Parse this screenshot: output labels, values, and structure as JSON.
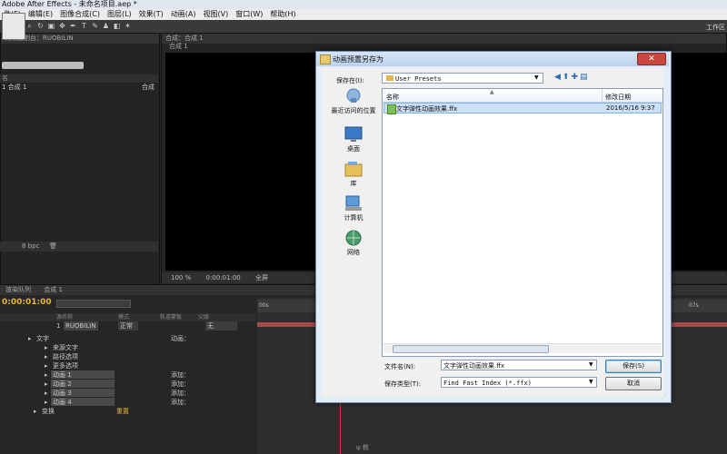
{
  "app": {
    "window_title": "Adobe After Effects - 未命名项目.aep *",
    "menu": [
      "件(F)",
      "编辑(E)",
      "图像合成(C)",
      "图层(L)",
      "效果(T)",
      "动画(A)",
      "视图(V)",
      "窗口(W)",
      "帮助(H)"
    ],
    "workspace_label": "工作区"
  },
  "project": {
    "tab_label": "特效控制台：RUOBILIN",
    "header_label": "名",
    "comp_item": "1 合成 1",
    "side_label": "合成",
    "bpc": "8 bpc"
  },
  "viewer": {
    "tab_label": "合成：合成 1",
    "sub_tab": "合成 1",
    "zoom": "100 %",
    "time": "0:00:01:00",
    "view": "全屏"
  },
  "timeline": {
    "tabs": [
      "渲染队列",
      "合成 1"
    ],
    "timecode": "0:00:01:00",
    "col_head": "源名称",
    "col_mode": "模式",
    "col_track": "轨道蒙板",
    "col_parent": "父级",
    "layer_number": "1",
    "layer_name": "RUOBILIN",
    "layer_mode": "正常",
    "layer_parent": "无",
    "rows": [
      {
        "label": "文字",
        "indent": 40,
        "right": "动画："
      },
      {
        "label": "来源文字",
        "indent": 58,
        "right": ""
      },
      {
        "label": "路径选项",
        "indent": 58,
        "right": ""
      },
      {
        "label": "更多选项",
        "indent": 58,
        "right": ""
      },
      {
        "label": "动画 1",
        "indent": 58,
        "right": "添加："
      },
      {
        "label": "动画 2",
        "indent": 58,
        "right": "添加："
      },
      {
        "label": "动画 3",
        "indent": 58,
        "right": "添加："
      },
      {
        "label": "动画 4",
        "indent": 58,
        "right": "添加："
      },
      {
        "label": "变换",
        "indent": 46,
        "right": ""
      }
    ],
    "reset_label": "重置",
    "ruler_start": "00s",
    "ruler_end": "07s"
  },
  "dialog": {
    "title": "动画预置另存为",
    "close_glyph": "✕",
    "save_in_label": "保存在(I):",
    "save_in_value": "User Presets",
    "places": [
      {
        "label": "最近访问的位置",
        "icon": "recent-places-icon"
      },
      {
        "label": "桌面",
        "icon": "desktop-icon"
      },
      {
        "label": "库",
        "icon": "library-icon"
      },
      {
        "label": "计算机",
        "icon": "computer-icon"
      },
      {
        "label": "网络",
        "icon": "network-icon"
      }
    ],
    "col_name": "名称",
    "col_date": "修改日期",
    "file": {
      "name": "文字弹性动画效果.ffx",
      "date": "2016/5/16 9:37"
    },
    "filename_label": "文件名(N):",
    "filename_value": "文字弹性动画效果.ffx",
    "filetype_label": "保存类型(T):",
    "filetype_value": "Find Fast Index (*.ffx)",
    "save_button": "保存(S)",
    "cancel_button": "取消"
  },
  "watermark": "ψ 教"
}
